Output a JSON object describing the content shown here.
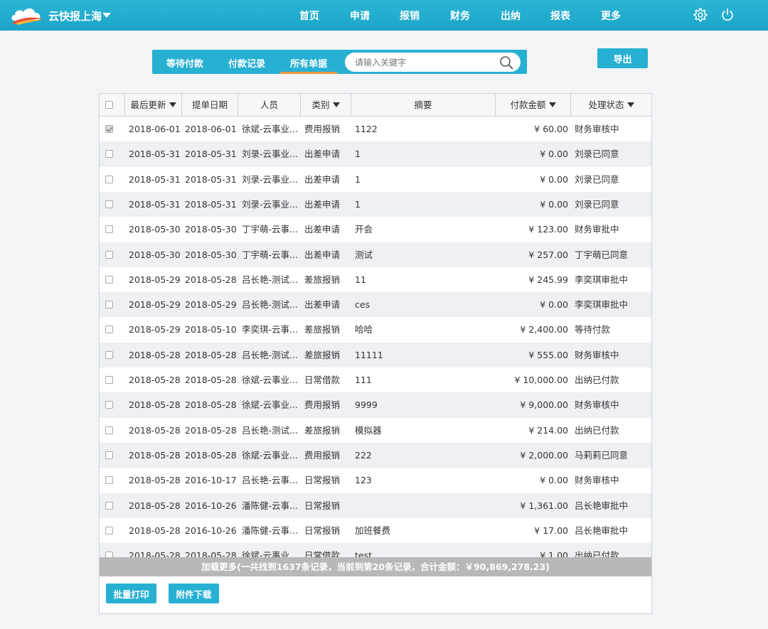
{
  "app": {
    "brand": "云快报上海"
  },
  "nav": [
    "首页",
    "申请",
    "报销",
    "财务",
    "出纳",
    "报表",
    "更多"
  ],
  "icons": {
    "logo": "cloud-logo",
    "settings": "gear-icon",
    "power": "power-icon",
    "search": "search-icon"
  },
  "colors": {
    "accent": "#27b0d2",
    "tab_underline": "#e89a3a",
    "load_more_bg": "#b8b8b8"
  },
  "tabs": [
    "等待付款",
    "付款记录",
    "所有单据"
  ],
  "active_tab": "所有单据",
  "search": {
    "placeholder": "请输入关键字",
    "value": ""
  },
  "export_label": "导出",
  "table": {
    "headers": [
      "最后更新",
      "提单日期",
      "人员",
      "类别",
      "摘要",
      "付款金额",
      "处理状态"
    ],
    "rows": [
      {
        "checked": true,
        "updated": "2018-06-01",
        "date": "2018-06-01",
        "person": "徐斌-云事业...",
        "type": "费用报销",
        "summary": "1122",
        "amount": "¥ 60.00",
        "status": "财务审核中"
      },
      {
        "checked": false,
        "updated": "2018-05-31",
        "date": "2018-05-31",
        "person": "刘录-云事业...",
        "type": "出差申请",
        "summary": "1",
        "amount": "¥ 0.00",
        "status": "刘录已同意"
      },
      {
        "checked": false,
        "updated": "2018-05-31",
        "date": "2018-05-31",
        "person": "刘录-云事业...",
        "type": "出差申请",
        "summary": "1",
        "amount": "¥ 0.00",
        "status": "刘录已同意"
      },
      {
        "checked": false,
        "updated": "2018-05-31",
        "date": "2018-05-31",
        "person": "刘录-云事业...",
        "type": "出差申请",
        "summary": "1",
        "amount": "¥ 0.00",
        "status": "刘录已同意"
      },
      {
        "checked": false,
        "updated": "2018-05-30",
        "date": "2018-05-30",
        "person": "丁宇萌-云事...",
        "type": "出差申请",
        "summary": "开会",
        "amount": "¥ 123.00",
        "status": "财务审批中"
      },
      {
        "checked": false,
        "updated": "2018-05-30",
        "date": "2018-05-30",
        "person": "丁宇萌-云事...",
        "type": "出差申请",
        "summary": "测试",
        "amount": "¥ 257.00",
        "status": "丁宇萌已同意"
      },
      {
        "checked": false,
        "updated": "2018-05-29",
        "date": "2018-05-28",
        "person": "吕长艳-测试...",
        "type": "差旅报销",
        "summary": "11",
        "amount": "¥ 245.99",
        "status": "李奕琪审批中"
      },
      {
        "checked": false,
        "updated": "2018-05-29",
        "date": "2018-05-29",
        "person": "吕长艳-测试...",
        "type": "出差申请",
        "summary": "ces",
        "amount": "¥ 0.00",
        "status": "李奕琪审批中"
      },
      {
        "checked": false,
        "updated": "2018-05-29",
        "date": "2018-05-10",
        "person": "李奕琪-云事...",
        "type": "差旅报销",
        "summary": "哈哈",
        "amount": "¥ 2,400.00",
        "status": "等待付款"
      },
      {
        "checked": false,
        "updated": "2018-05-28",
        "date": "2018-05-28",
        "person": "吕长艳-测试...",
        "type": "差旅报销",
        "summary": "11111",
        "amount": "¥ 555.00",
        "status": "财务审核中"
      },
      {
        "checked": false,
        "updated": "2018-05-28",
        "date": "2018-05-28",
        "person": "徐斌-云事业...",
        "type": "日常借款",
        "summary": "111",
        "amount": "¥ 10,000.00",
        "status": "出纳已付款"
      },
      {
        "checked": false,
        "updated": "2018-05-28",
        "date": "2018-05-28",
        "person": "徐斌-云事业...",
        "type": "费用报销",
        "summary": "9999",
        "amount": "¥ 9,000.00",
        "status": "财务审核中"
      },
      {
        "checked": false,
        "updated": "2018-05-28",
        "date": "2018-05-28",
        "person": "吕长艳-测试...",
        "type": "差旅报销",
        "summary": "模拟器",
        "amount": "¥ 214.00",
        "status": "出纳已付款"
      },
      {
        "checked": false,
        "updated": "2018-05-28",
        "date": "2018-05-28",
        "person": "徐斌-云事业...",
        "type": "费用报销",
        "summary": "222",
        "amount": "¥ 2,000.00",
        "status": "马莉莉已同意"
      },
      {
        "checked": false,
        "updated": "2018-05-28",
        "date": "2016-10-17",
        "person": "吕长艳-云事...",
        "type": "日常报销",
        "summary": "123",
        "amount": "¥ 0.00",
        "status": "财务审核中"
      },
      {
        "checked": false,
        "updated": "2018-05-28",
        "date": "2016-10-26",
        "person": "潘陈健-云事...",
        "type": "日常报销",
        "summary": "",
        "amount": "¥ 1,361.00",
        "status": "吕长艳审批中"
      },
      {
        "checked": false,
        "updated": "2018-05-28",
        "date": "2016-10-26",
        "person": "潘陈健-云事...",
        "type": "日常报销",
        "summary": "加班餐费",
        "amount": "¥ 17.00",
        "status": "吕长艳审批中"
      },
      {
        "checked": false,
        "updated": "2018-05-28",
        "date": "2018-05-28",
        "person": "徐斌-云事业...",
        "type": "日常借款",
        "summary": "test",
        "amount": "¥ 1.00",
        "status": "出纳已付款"
      }
    ]
  },
  "load_more": "加载更多(一共找到1637条记录，当前到第20条记录，合计金额：￥90,869,278.23)",
  "buttons": {
    "batch_print": "批量打印",
    "attachment_download": "附件下载"
  }
}
